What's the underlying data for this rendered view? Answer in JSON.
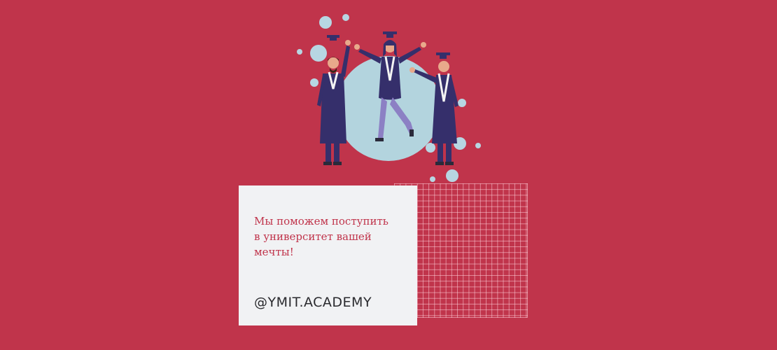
{
  "card": {
    "text": "Мы поможем поступить в университет вашей мечты!",
    "handle": "@YMIT.ACADEMY"
  },
  "colors": {
    "background": "#c0344b",
    "card": "#f1f2f4",
    "accent_text": "#c0344b",
    "gown": "#352f6b",
    "circle": "#b3d4de",
    "bubble": "#b7d6e2",
    "skin": "#e8a98b"
  }
}
